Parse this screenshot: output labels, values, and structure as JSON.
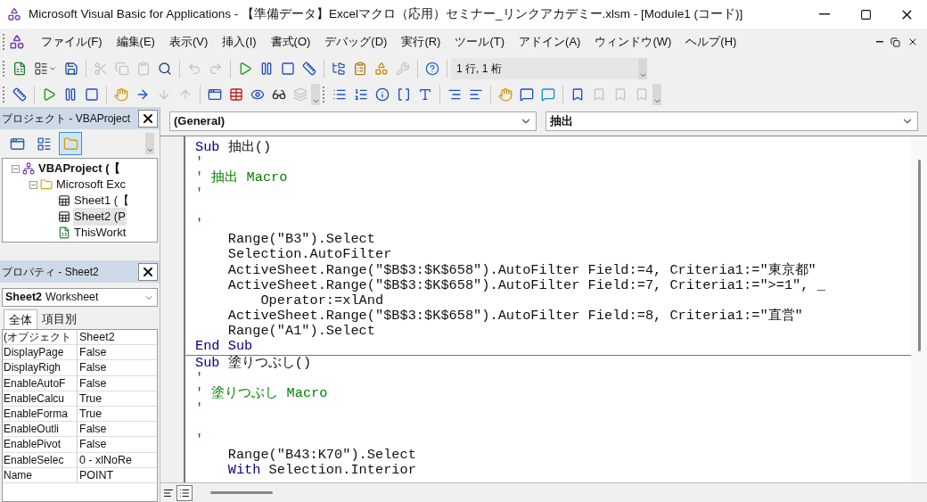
{
  "window": {
    "title": "Microsoft Visual Basic for Applications - 【準備データ】Excelマクロ（応用）セミナー_リンクアカデミー.xlsm - [Module1 (コード)]"
  },
  "menu": [
    "ファイル(F)",
    "編集(E)",
    "表示(V)",
    "挿入(I)",
    "書式(O)",
    "デバッグ(D)",
    "実行(R)",
    "ツール(T)",
    "アドイン(A)",
    "ウィンドウ(W)",
    "ヘルプ(H)"
  ],
  "toolbars": [
    {
      "items": [
        {
          "kind": "excel",
          "disabled": false
        },
        {
          "kind": "userform",
          "disabled": false
        },
        {
          "kind": "save",
          "disabled": false
        },
        {
          "kind": "separator"
        },
        {
          "kind": "cut",
          "disabled": true
        },
        {
          "kind": "copy",
          "disabled": true
        },
        {
          "kind": "paste",
          "disabled": true
        },
        {
          "kind": "find",
          "disabled": false
        },
        {
          "kind": "separator"
        },
        {
          "kind": "undo",
          "disabled": true
        },
        {
          "kind": "redo",
          "disabled": true
        },
        {
          "kind": "separator"
        },
        {
          "kind": "run",
          "disabled": false
        },
        {
          "kind": "pause",
          "disabled": false
        },
        {
          "kind": "stop",
          "disabled": false
        },
        {
          "kind": "design",
          "disabled": false
        },
        {
          "kind": "separator"
        },
        {
          "kind": "project",
          "disabled": false
        },
        {
          "kind": "properties",
          "disabled": false
        },
        {
          "kind": "browser",
          "disabled": false
        },
        {
          "kind": "toolbox",
          "disabled": true
        },
        {
          "kind": "separator"
        },
        {
          "kind": "help",
          "disabled": false
        }
      ],
      "position": "1 行, 1 桁"
    },
    {
      "items": [
        {
          "kind": "design",
          "disabled": false
        },
        {
          "kind": "separator"
        },
        {
          "kind": "run",
          "disabled": false
        },
        {
          "kind": "pause",
          "disabled": false
        },
        {
          "kind": "stop",
          "disabled": false
        },
        {
          "kind": "separator"
        },
        {
          "kind": "breakpoint",
          "disabled": false
        },
        {
          "kind": "step-into",
          "disabled": false
        },
        {
          "kind": "step-over",
          "disabled": true
        },
        {
          "kind": "step-out",
          "disabled": true
        },
        {
          "kind": "separator"
        },
        {
          "kind": "locals",
          "disabled": false
        },
        {
          "kind": "immediate",
          "disabled": false
        },
        {
          "kind": "watch",
          "disabled": false
        },
        {
          "kind": "quickwatch",
          "disabled": false
        },
        {
          "kind": "callstack",
          "disabled": true
        }
      ]
    },
    {
      "items": [
        {
          "kind": "list-properties",
          "disabled": false
        },
        {
          "kind": "list-constants",
          "disabled": false
        },
        {
          "kind": "quick-info",
          "disabled": false
        },
        {
          "kind": "parameter-info",
          "disabled": false
        },
        {
          "kind": "complete-word",
          "disabled": false
        },
        {
          "kind": "separator"
        },
        {
          "kind": "indent",
          "disabled": false
        },
        {
          "kind": "outdent",
          "disabled": false
        },
        {
          "kind": "separator"
        },
        {
          "kind": "breakpoint",
          "disabled": false
        },
        {
          "kind": "comment",
          "disabled": false
        },
        {
          "kind": "uncomment",
          "disabled": false
        },
        {
          "kind": "separator"
        },
        {
          "kind": "bookmark",
          "disabled": false
        },
        {
          "kind": "next-bookmark",
          "disabled": true
        },
        {
          "kind": "prev-bookmark",
          "disabled": true
        },
        {
          "kind": "clear-bookmarks",
          "disabled": true
        }
      ]
    }
  ],
  "project_panel": {
    "title": "プロジェクト - VBAProject",
    "view_buttons": [
      {
        "kind": "code",
        "selected": false
      },
      {
        "kind": "object",
        "selected": false
      },
      {
        "kind": "folders",
        "selected": true
      }
    ],
    "tree": [
      {
        "label": "VBAProject (【",
        "kind": "project",
        "expanded": true,
        "selected": false,
        "children": [
          {
            "label": "Microsoft Exc",
            "kind": "folder",
            "expanded": true,
            "selected": false,
            "children": [
              {
                "label": "Sheet1 (【",
                "kind": "sheet",
                "selected": false
              },
              {
                "label": "Sheet2 (P",
                "kind": "sheet",
                "selected": true
              },
              {
                "label": "ThisWorkt",
                "kind": "workbook",
                "selected": false
              }
            ]
          }
        ]
      }
    ]
  },
  "properties_panel": {
    "title": "プロパティ - Sheet2",
    "object_name": "Sheet2",
    "object_type": "Worksheet",
    "tabs": [
      {
        "label": "全体",
        "selected": true
      },
      {
        "label": "項目別",
        "selected": false
      }
    ],
    "rows": [
      {
        "name": "(オブジェクト",
        "value": "Sheet2"
      },
      {
        "name": "DisplayPage",
        "value": "False"
      },
      {
        "name": "DisplayRigh",
        "value": "False"
      },
      {
        "name": "EnableAutoF",
        "value": "False"
      },
      {
        "name": "EnableCalcu",
        "value": "True"
      },
      {
        "name": "EnableForma",
        "value": "True"
      },
      {
        "name": "EnableOutli",
        "value": "False"
      },
      {
        "name": "EnablePivot",
        "value": "False"
      },
      {
        "name": "EnableSelec",
        "value": "0 - xlNoRe"
      },
      {
        "name": "Name",
        "value": "POINT"
      }
    ]
  },
  "code_window": {
    "object_box": "(General)",
    "procedure_box": "抽出",
    "procedures": [
      {
        "lines": [
          {
            "kind": "code",
            "segments": [
              {
                "kind": "keyword",
                "text": "Sub"
              },
              {
                "kind": "plain",
                "text": " 抽出()"
              }
            ]
          },
          {
            "kind": "code",
            "segments": [
              {
                "kind": "comment",
                "text": "'"
              }
            ]
          },
          {
            "kind": "code",
            "segments": [
              {
                "kind": "comment",
                "text": "' 抽出 Macro"
              }
            ]
          },
          {
            "kind": "code",
            "segments": [
              {
                "kind": "comment",
                "text": "'"
              }
            ]
          },
          {
            "kind": "blank"
          },
          {
            "kind": "code",
            "segments": [
              {
                "kind": "comment",
                "text": "'"
              }
            ]
          },
          {
            "kind": "code",
            "segments": [
              {
                "kind": "plain",
                "text": "    Range(\"B3\").Select"
              }
            ]
          },
          {
            "kind": "code",
            "segments": [
              {
                "kind": "plain",
                "text": "    Selection.AutoFilter"
              }
            ]
          },
          {
            "kind": "code",
            "segments": [
              {
                "kind": "plain",
                "text": "    ActiveSheet.Range(\"$B$3:$K$658\").AutoFilter Field:=4, Criteria1:=\"東京都\""
              }
            ]
          },
          {
            "kind": "code",
            "segments": [
              {
                "kind": "plain",
                "text": "    ActiveSheet.Range(\"$B$3:$K$658\").AutoFilter Field:=7, Criteria1:=\">=1\", _"
              }
            ]
          },
          {
            "kind": "code",
            "segments": [
              {
                "kind": "plain",
                "text": "        Operator:=xlAnd"
              }
            ]
          },
          {
            "kind": "code",
            "segments": [
              {
                "kind": "plain",
                "text": "    ActiveSheet.Range(\"$B$3:$K$658\").AutoFilter Field:=8, Criteria1:=\"直営\""
              }
            ]
          },
          {
            "kind": "code",
            "segments": [
              {
                "kind": "plain",
                "text": "    Range(\"A1\").Select"
              }
            ]
          },
          {
            "kind": "code",
            "segments": [
              {
                "kind": "keyword",
                "text": "End Sub"
              }
            ]
          }
        ]
      },
      {
        "lines": [
          {
            "kind": "code",
            "segments": [
              {
                "kind": "keyword",
                "text": "Sub"
              },
              {
                "kind": "plain",
                "text": " 塗りつぶし()"
              }
            ]
          },
          {
            "kind": "code",
            "segments": [
              {
                "kind": "comment",
                "text": "'"
              }
            ]
          },
          {
            "kind": "code",
            "segments": [
              {
                "kind": "comment",
                "text": "' 塗りつぶし Macro"
              }
            ]
          },
          {
            "kind": "code",
            "segments": [
              {
                "kind": "comment",
                "text": "'"
              }
            ]
          },
          {
            "kind": "blank"
          },
          {
            "kind": "code",
            "segments": [
              {
                "kind": "comment",
                "text": "'"
              }
            ]
          },
          {
            "kind": "code",
            "segments": [
              {
                "kind": "plain",
                "text": "    Range(\"B43:K70\").Select"
              }
            ]
          },
          {
            "kind": "code",
            "segments": [
              {
                "kind": "keyword",
                "text": "    With"
              },
              {
                "kind": "plain",
                "text": " Selection.Interior"
              }
            ]
          }
        ]
      }
    ],
    "view_buttons": [
      {
        "kind": "procedure",
        "selected": false
      },
      {
        "kind": "module",
        "selected": true
      }
    ]
  }
}
